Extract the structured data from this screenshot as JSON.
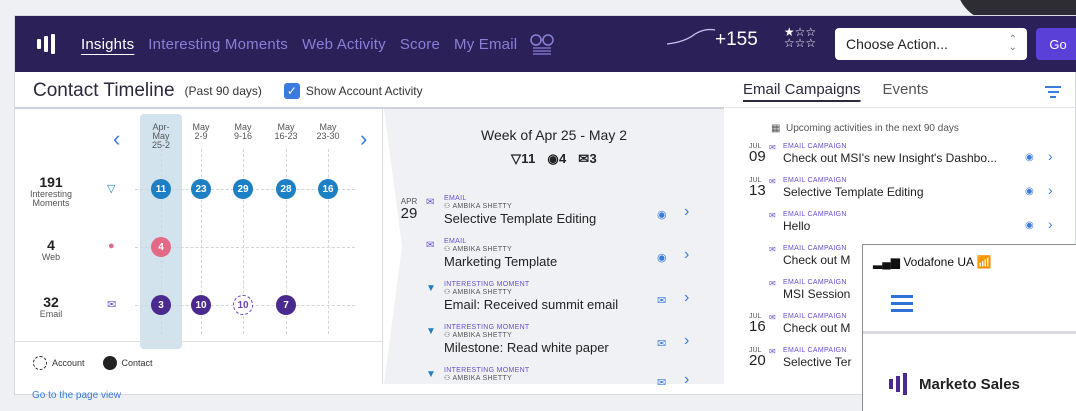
{
  "topbar": {
    "tabs": [
      {
        "label": "Insights",
        "active": true
      },
      {
        "label": "Interesting Moments",
        "active": false
      },
      {
        "label": "Web Activity",
        "active": false
      },
      {
        "label": "Score",
        "active": false
      },
      {
        "label": "My Email",
        "active": false
      }
    ],
    "score": "+155",
    "action_select": "Choose Action...",
    "go_label": "Go"
  },
  "timeline": {
    "title": "Contact Timeline",
    "subtitle": "(Past 90 days)",
    "show_activity_label": "Show Account Activity",
    "show_activity_checked": true,
    "weeks": [
      {
        "label": "Apr-May",
        "range": "25-2",
        "selected": true
      },
      {
        "label": "May",
        "range": "2-9",
        "selected": false
      },
      {
        "label": "May",
        "range": "9-16",
        "selected": false
      },
      {
        "label": "May",
        "range": "16-23",
        "selected": false
      },
      {
        "label": "May",
        "range": "23-30",
        "selected": false
      }
    ],
    "rows": [
      {
        "count": "191",
        "label1": "Interesting",
        "label2": "Moments",
        "icon": "interesting-moment-icon"
      },
      {
        "count": "4",
        "label1": "Web",
        "label2": "",
        "icon": "web-dot-icon"
      },
      {
        "count": "32",
        "label1": "Email",
        "label2": "",
        "icon": "email-icon"
      }
    ],
    "dots": {
      "moments": [
        "11",
        "23",
        "29",
        "28",
        "16"
      ],
      "web": [
        "4"
      ],
      "email": [
        "3",
        "10",
        "10",
        "7"
      ]
    },
    "legend": {
      "account": "Account",
      "contact": "Contact"
    }
  },
  "week_panel": {
    "title": "Week of Apr 25 - May 2",
    "stats": {
      "moments": "11",
      "web": "4",
      "email": "3"
    },
    "date": {
      "month": "APR",
      "day": "29"
    },
    "events": [
      {
        "type": "EMAIL",
        "who": "AMBIKA SHETTY",
        "title": "Selective Template Editing"
      },
      {
        "type": "EMAIL",
        "who": "AMBIKA SHETTY",
        "title": "Marketing Template"
      },
      {
        "type": "INTERESTING MOMENT",
        "who": "AMBIKA SHETTY",
        "title": "Email: Received summit email"
      },
      {
        "type": "INTERESTING MOMENT",
        "who": "AMBIKA SHETTY",
        "title": "Milestone: Read white paper"
      },
      {
        "type": "INTERESTING MOMENT",
        "who": "AMBIKA SHETTY",
        "title": ""
      }
    ]
  },
  "campaigns": {
    "tabs": [
      {
        "label": "Email Campaigns",
        "active": true
      },
      {
        "label": "Events",
        "active": false
      }
    ],
    "upcoming": "Upcoming activities in the next 90 days",
    "items": [
      {
        "month": "JUL",
        "day": "09",
        "type": "EMAIL CAMPAIGN",
        "title": "Check out MSI's new Insight's Dashbo..."
      },
      {
        "month": "JUL",
        "day": "13",
        "type": "EMAIL CAMPAIGN",
        "title": "Selective Template Editing"
      },
      {
        "month": "",
        "day": "",
        "type": "EMAIL CAMPAIGN",
        "title": "Hello"
      },
      {
        "month": "",
        "day": "",
        "type": "EMAIL CAMPAIGN",
        "title": "Check out M"
      },
      {
        "month": "",
        "day": "",
        "type": "EMAIL CAMPAIGN",
        "title": "MSI Session"
      },
      {
        "month": "JUL",
        "day": "16",
        "type": "EMAIL CAMPAIGN",
        "title": "Check out M"
      },
      {
        "month": "JUL",
        "day": "20",
        "type": "EMAIL CAMPAIGN",
        "title": "Selective Ter"
      }
    ]
  },
  "footer_link": "Go to the page view",
  "phone": {
    "carrier": "Vodafone UA",
    "app_name": "Marketo Sales"
  }
}
